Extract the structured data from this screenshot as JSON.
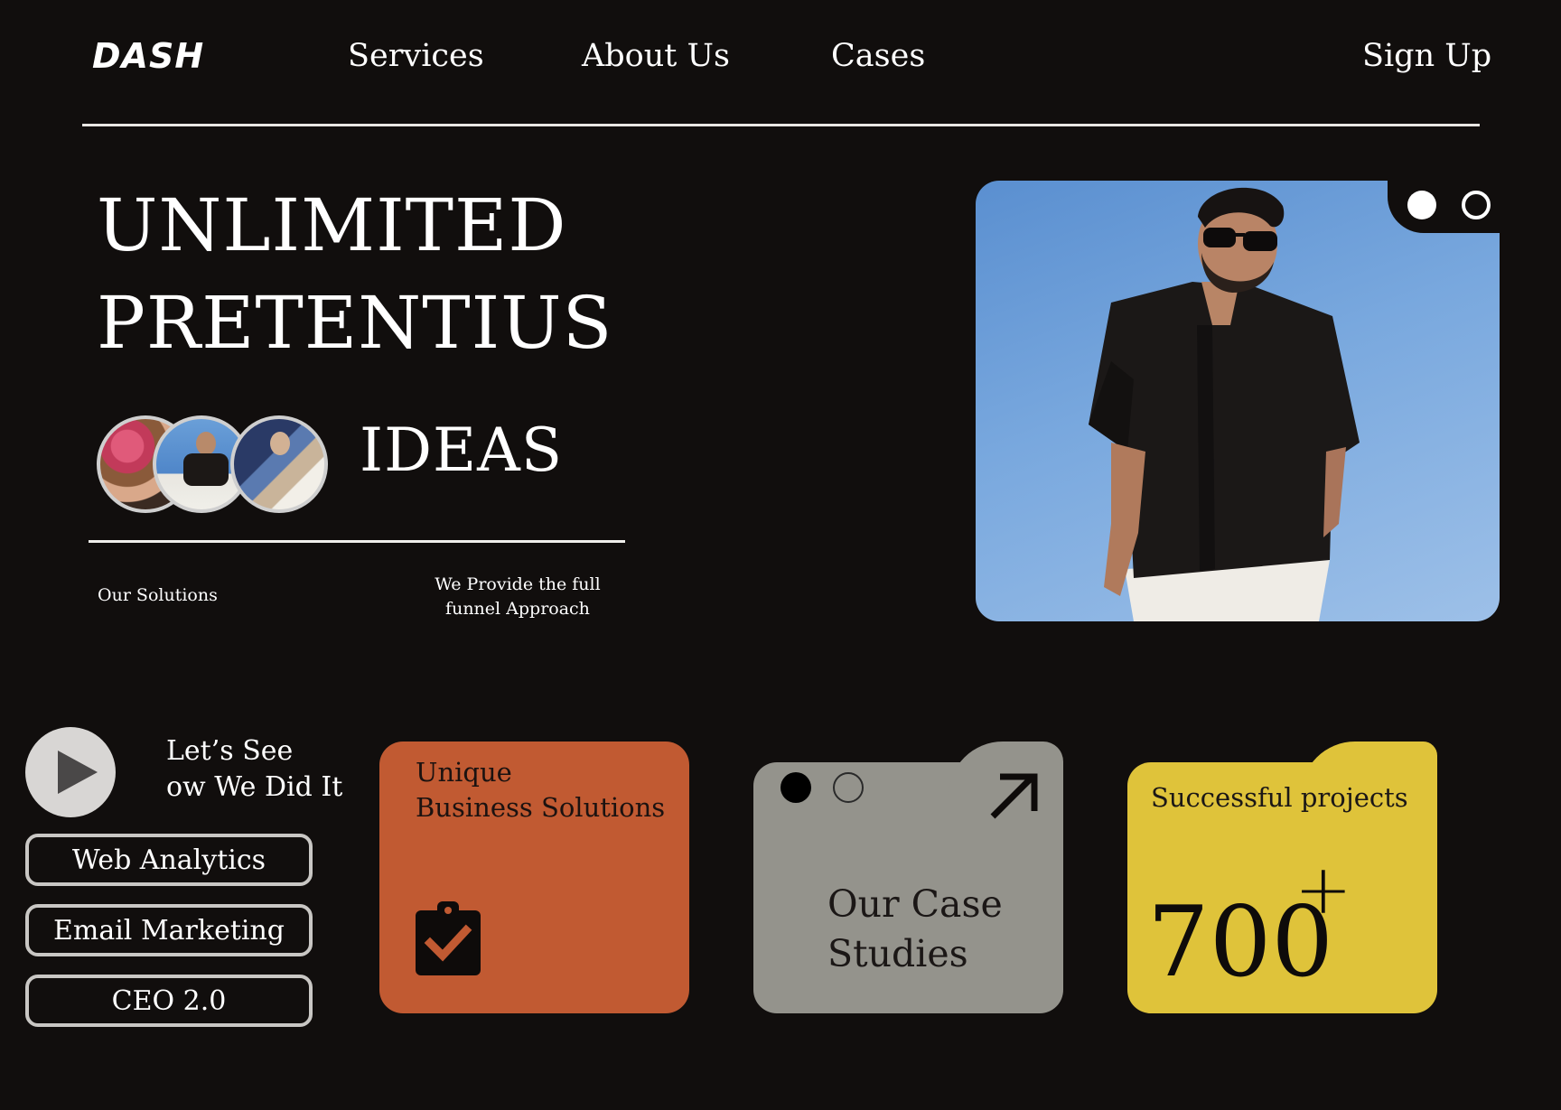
{
  "nav": {
    "logo": "DASH",
    "links": [
      "Services",
      "About Us",
      "Cases"
    ],
    "signup": "Sign Up"
  },
  "hero": {
    "line1": "UNLIMITED",
    "line2": "PRETENTIUS",
    "line3": "IDEAS",
    "sub_left": "Our Solutions",
    "sub_right": "We Provide the full funnel Approach"
  },
  "cta": {
    "text_line1": "Let’s See",
    "text_line2": "ow We Did It",
    "pills": [
      "Web Analytics",
      "Email Marketing",
      "CEO 2.0"
    ]
  },
  "cards": {
    "orange": {
      "line1": "Unique",
      "line2": "Business Solutions",
      "icon": "clipboard-check-icon",
      "color": "#c15a32"
    },
    "grey": {
      "line1": "Our Case",
      "line2": "Studies",
      "icon": "arrow-up-right-icon",
      "color": "#94938c"
    },
    "yellow": {
      "title": "Successful projects",
      "number": "700",
      "suffix": "+",
      "color": "#dfc33a"
    }
  },
  "colors": {
    "background": "#110e0d",
    "text": "#ffffff"
  }
}
